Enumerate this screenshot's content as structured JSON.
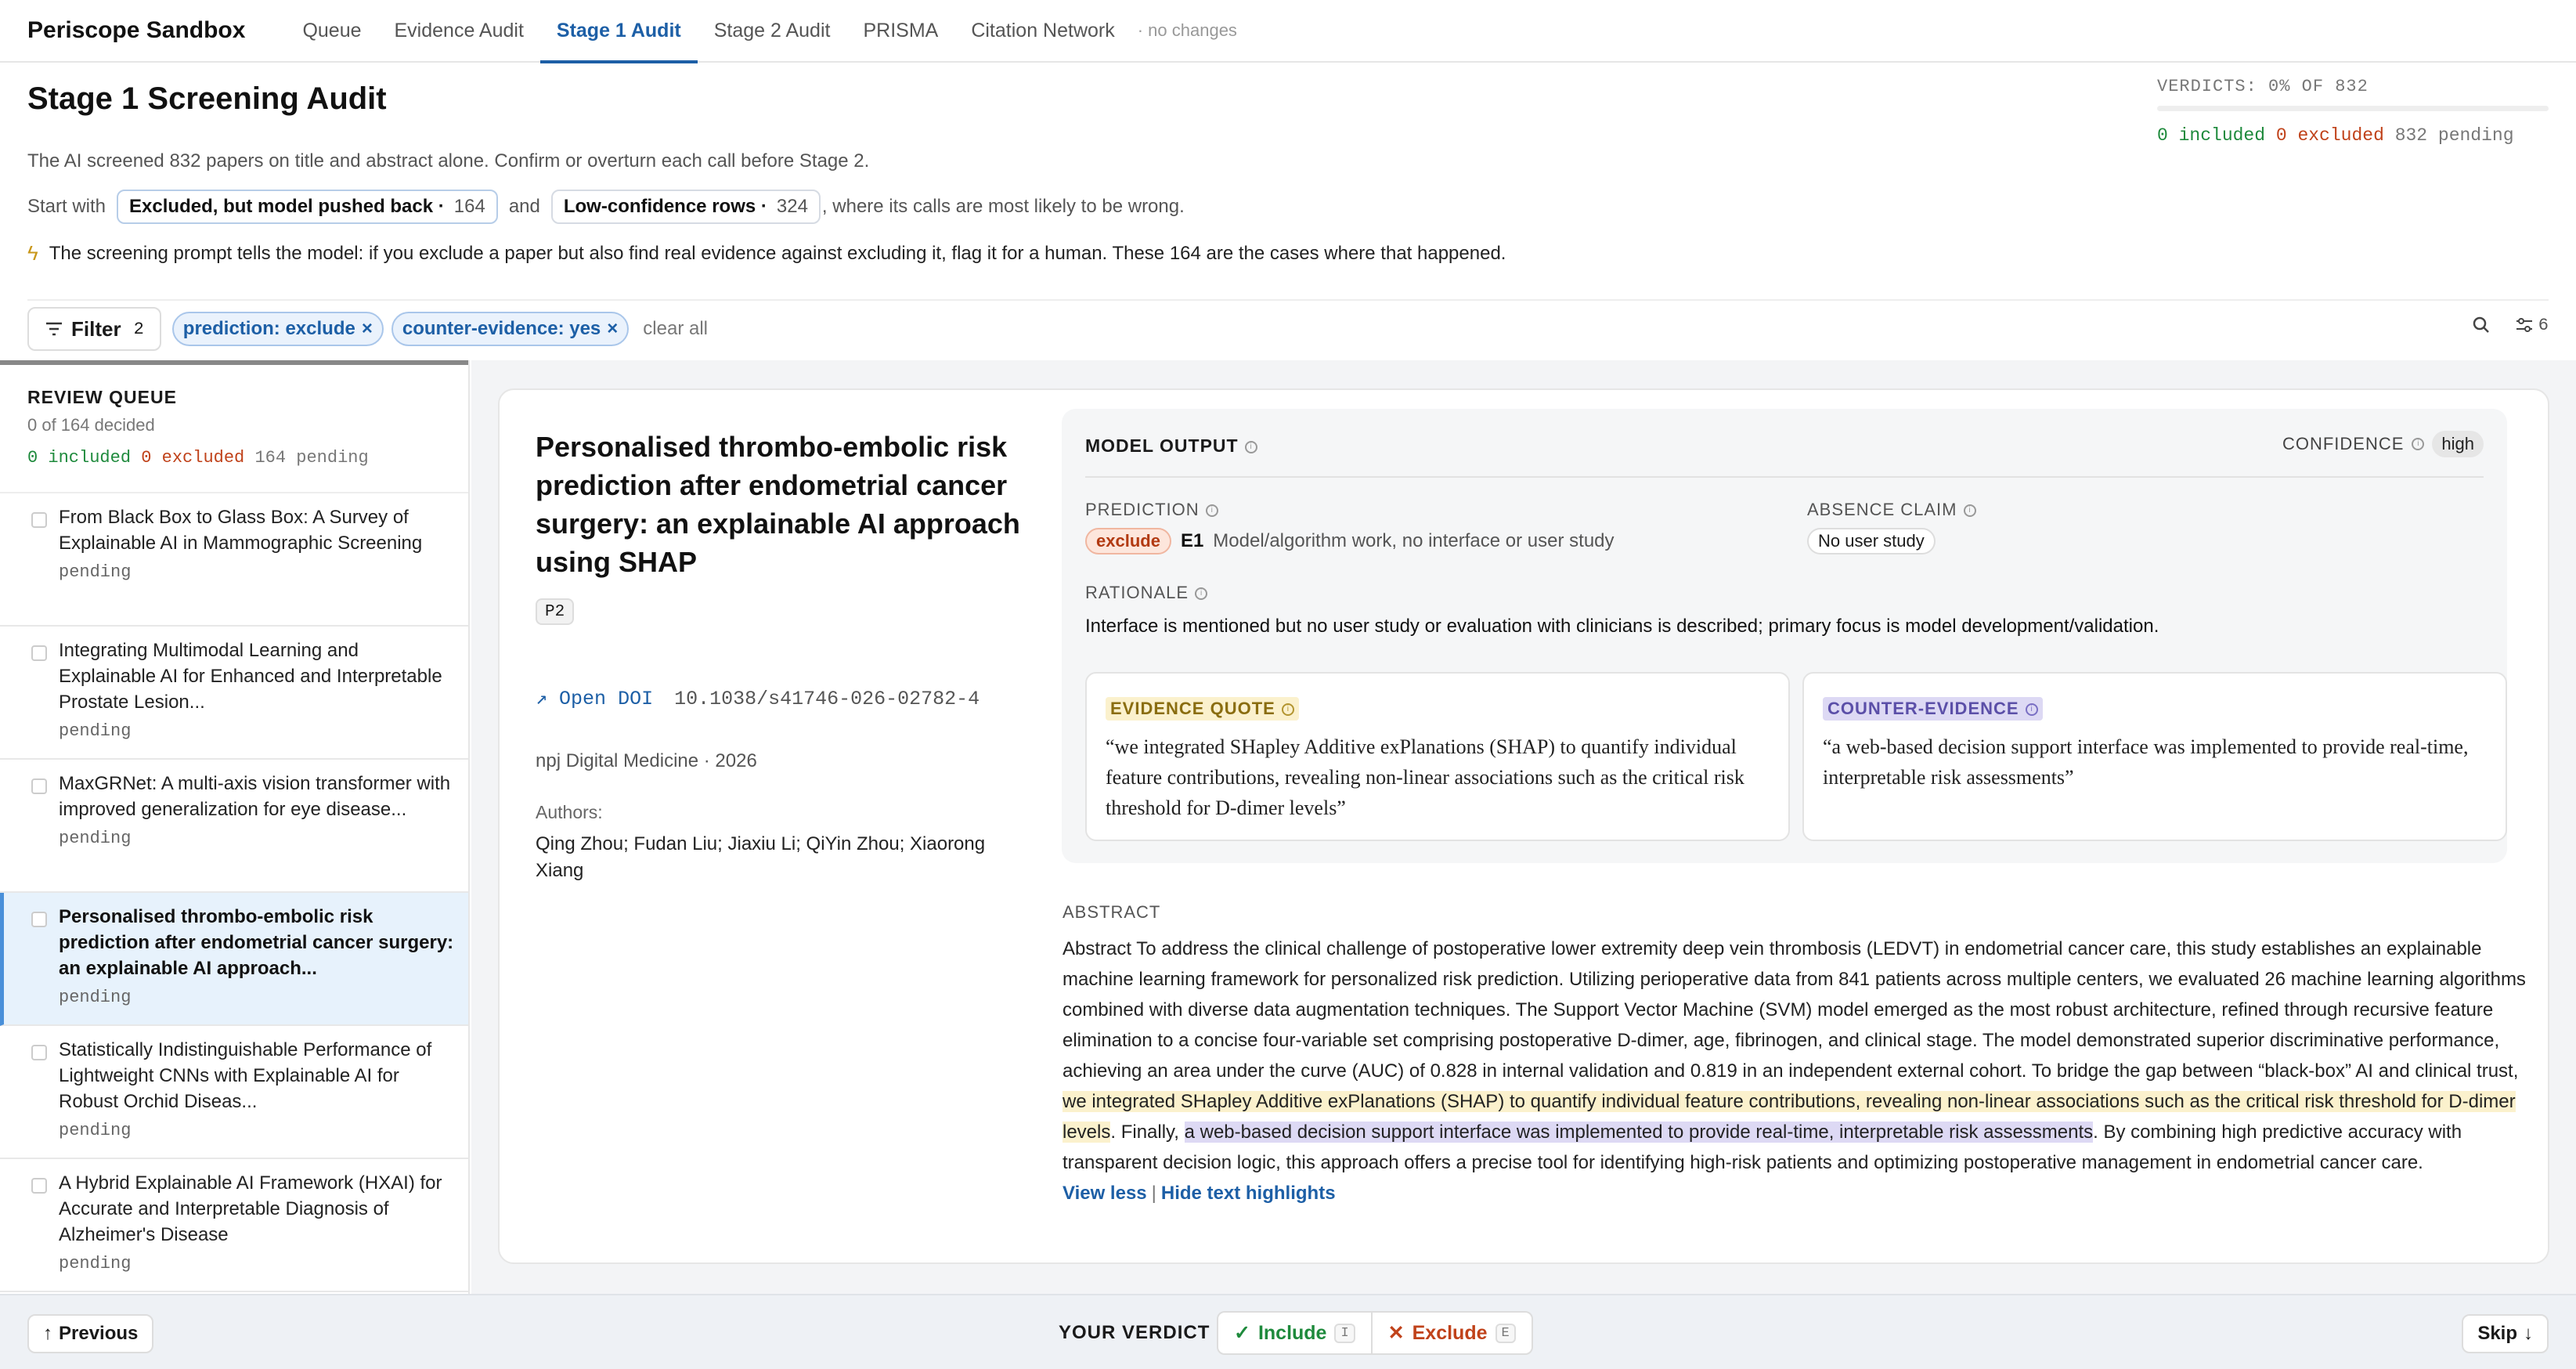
{
  "app": {
    "title": "Periscope Sandbox"
  },
  "nav": {
    "tabs": [
      "Queue",
      "Evidence Audit",
      "Stage 1 Audit",
      "Stage 2 Audit",
      "PRISMA",
      "Citation Network"
    ],
    "status": "· no changes"
  },
  "header": {
    "title": "Stage 1 Screening Audit",
    "verdicts_label": "VERDICTS: 0% OF 832",
    "verdicts_progress": 0,
    "included": "0 included",
    "excluded": "0 excluded",
    "pending": "832 pending",
    "subtitle": "The AI screened 832 papers on title and abstract alone. Confirm or overturn each call before Stage 2.",
    "start_prefix": "Start with",
    "chip1_label": "Excluded, but model pushed back ·",
    "chip1_count": "164",
    "start_and": "and",
    "chip2_label": "Low-confidence rows ·",
    "chip2_count": "324",
    "start_suffix": ", where its calls are most likely to be wrong.",
    "tip": "The screening prompt tells the model: if you exclude a paper but also find real evidence against excluding it, flag it for a human. These 164 are the cases where that happened."
  },
  "filters": {
    "button_label": "Filter",
    "button_count": "2",
    "pills": [
      "prediction: exclude",
      "counter-evidence: yes"
    ],
    "clear": "clear all",
    "columns_count": "6"
  },
  "queue": {
    "title": "REVIEW QUEUE",
    "decided": "0 of 164 decided",
    "included": "0 included",
    "excluded": "0 excluded",
    "pending": "164 pending",
    "items": [
      {
        "title": "From Black Box to Glass Box: A Survey of Explainable AI in Mammographic Screening",
        "status": "pending"
      },
      {
        "title": "Integrating Multimodal Learning and Explainable AI for Enhanced and Interpretable Prostate Lesion...",
        "status": "pending"
      },
      {
        "title": "MaxGRNet: A multi-axis vision transformer with improved generalization for eye disease...",
        "status": "pending"
      },
      {
        "title": "Personalised thrombo-embolic risk prediction after endometrial cancer surgery: an explainable AI approach...",
        "status": "pending"
      },
      {
        "title": "Statistically Indistinguishable Performance of Lightweight CNNs with Explainable AI for Robust Orchid Diseas...",
        "status": "pending"
      },
      {
        "title": "A Hybrid Explainable AI Framework (HXAI) for Accurate and Interpretable Diagnosis of Alzheimer's Disease",
        "status": "pending"
      }
    ]
  },
  "paper": {
    "title": "Personalised thrombo-embolic risk prediction after endometrial cancer surgery: an explainable AI approach using SHAP",
    "tag": "P2",
    "doi_link": "↗ Open DOI",
    "doi": "10.1038/s41746-026-02782-4",
    "journal": "npj Digital Medicine · 2026",
    "authors_label": "Authors:",
    "authors": "Qing Zhou; Fudan Liu; Jiaxiu Li; QiYin Zhou; Xiaorong Xiang"
  },
  "model_output": {
    "title": "MODEL OUTPUT",
    "confidence_label": "CONFIDENCE",
    "confidence": "high",
    "prediction_label": "PREDICTION",
    "prediction": "exclude",
    "code": "E1",
    "code_desc": "Model/algorithm work, no interface or user study",
    "absence_label": "ABSENCE CLAIM",
    "absence": "No user study",
    "rationale_label": "RATIONALE",
    "rationale": "Interface is mentioned but no user study or evaluation with clinicians is described; primary focus is model development/validation.",
    "evidence_label": "EVIDENCE QUOTE",
    "evidence": "“we integrated SHapley Additive exPlanations (SHAP) to quantify individual feature contributions, revealing non-linear associations such as the critical risk threshold for D-dimer levels”",
    "counter_label": "COUNTER-EVIDENCE",
    "counter": "“a web-based decision support interface was implemented to provide real-time, interpretable risk assessments”"
  },
  "abstract": {
    "label": "ABSTRACT",
    "part1": "Abstract To address the clinical challenge of postoperative lower extremity deep vein thrombosis (LEDVT) in endometrial cancer care, this study establishes an explainable machine learning framework for personalized risk prediction. Utilizing perioperative data from 841 patients across multiple centers, we evaluated 26 machine learning algorithms combined with diverse data augmentation techniques. The Support Vector Machine (SVM) model emerged as the most robust architecture, refined through recursive feature elimination to a concise four-variable set comprising postoperative D-dimer, age, fibrinogen, and clinical stage. The model demonstrated superior discriminative performance, achieving an area under the curve (AUC) of 0.828 in internal validation and 0.819 in an independent external cohort. To bridge the gap between “black-box” AI and clinical trust, ",
    "highlight1": "we integrated SHapley Additive exPlanations (SHAP) to quantify individual feature contributions, revealing non-linear associations such as the critical risk threshold for D-dimer levels",
    "part2": ". Finally, ",
    "highlight2": "a web-based decision support interface was implemented to provide real-time, interpretable risk assessments",
    "part3": ". By combining high predictive accuracy with transparent decision logic, this approach offers a precise tool for identifying high-risk patients and optimizing postoperative management in endometrial cancer care.",
    "view_less": "View less",
    "hide_highlights": "Hide text highlights"
  },
  "footer": {
    "previous": "Previous",
    "verdict_label": "YOUR VERDICT",
    "include": "Include",
    "include_key": "I",
    "exclude": "Exclude",
    "exclude_key": "E",
    "skip": "Skip"
  },
  "colors": {
    "accent": "#1d5fa6",
    "included": "#1e8a3c",
    "excluded": "#c0421a",
    "evidence": "#fbf1cd",
    "counter": "#ddd9f4"
  }
}
